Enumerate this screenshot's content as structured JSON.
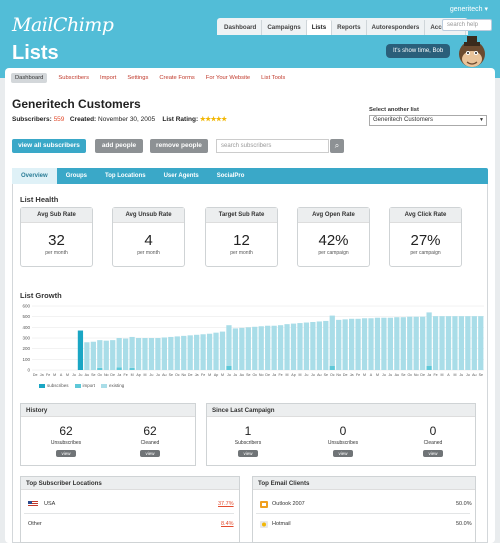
{
  "brand": "MailChimp",
  "user": "generitech",
  "nav": [
    "Dashboard",
    "Campaigns",
    "Lists",
    "Reports",
    "Autoresponders",
    "Account"
  ],
  "nav_active": 2,
  "help_placeholder": "search help",
  "page_title": "Lists",
  "show_time": "It's show time, Bob",
  "subnav": [
    "Dashboard",
    "Subscribers",
    "Import",
    "Settings",
    "Create Forms",
    "For Your Website",
    "List Tools"
  ],
  "list": {
    "name": "Generitech Customers",
    "subscribers_label": "Subscribers:",
    "subscribers": "559",
    "created_label": "Created:",
    "created": "November 30, 2005",
    "rating_label": "List Rating:",
    "rating": "★★★★★"
  },
  "select_label": "Select another list",
  "select_value": "Generitech Customers",
  "buttons": {
    "view_all": "view all subscribers",
    "add": "add people",
    "remove": "remove people"
  },
  "search_placeholder": "search subscribers",
  "tabs": [
    "Overview",
    "Groups",
    "Top Locations",
    "User Agents",
    "SocialPro"
  ],
  "health_title": "List Health",
  "health": [
    {
      "label": "Avg Sub Rate",
      "value": "32",
      "unit": "per month"
    },
    {
      "label": "Avg Unsub Rate",
      "value": "4",
      "unit": "per month"
    },
    {
      "label": "Target Sub Rate",
      "value": "12",
      "unit": "per month"
    },
    {
      "label": "Avg Open Rate",
      "value": "42%",
      "unit": "per campaign"
    },
    {
      "label": "Avg Click Rate",
      "value": "27%",
      "unit": "per campaign"
    }
  ],
  "growth_title": "List Growth",
  "chart_data": {
    "type": "bar",
    "stacked": true,
    "ylim": [
      0,
      600
    ],
    "yticks": [
      0,
      100,
      200,
      300,
      400,
      500,
      600
    ],
    "series": [
      {
        "name": "subscribes",
        "color": "#1aa6c4",
        "values": [
          0,
          0,
          0,
          0,
          0,
          0,
          0,
          370,
          0,
          0,
          0,
          0,
          0,
          0,
          0,
          0,
          0,
          0,
          0,
          0,
          0,
          0,
          0,
          0,
          0,
          0,
          0,
          0,
          0,
          0,
          0,
          0,
          0,
          0,
          0,
          0,
          0,
          0,
          0,
          0,
          0,
          0,
          0,
          0,
          0,
          0,
          0,
          0,
          0,
          0,
          0,
          0,
          0,
          0,
          0,
          0,
          0,
          0,
          0,
          0,
          0,
          0,
          0,
          0,
          0,
          0,
          0,
          0,
          0,
          0
        ]
      },
      {
        "name": "import",
        "color": "#5ec8d8",
        "values": [
          0,
          0,
          0,
          0,
          0,
          0,
          0,
          0,
          0,
          0,
          20,
          0,
          0,
          25,
          0,
          20,
          0,
          0,
          0,
          0,
          0,
          0,
          0,
          0,
          0,
          0,
          0,
          0,
          0,
          0,
          40,
          0,
          0,
          0,
          0,
          0,
          0,
          0,
          0,
          0,
          0,
          0,
          0,
          0,
          0,
          0,
          40,
          0,
          0,
          0,
          0,
          0,
          0,
          0,
          0,
          0,
          0,
          0,
          0,
          0,
          0,
          40,
          0,
          0,
          0,
          0,
          0,
          0,
          0,
          0
        ]
      },
      {
        "name": "existing",
        "color": "#a9dde8",
        "values": [
          0,
          0,
          0,
          0,
          0,
          0,
          0,
          0,
          260,
          265,
          260,
          275,
          280,
          275,
          295,
          290,
          300,
          300,
          300,
          300,
          305,
          310,
          315,
          320,
          325,
          330,
          335,
          340,
          350,
          360,
          380,
          390,
          395,
          400,
          405,
          410,
          415,
          415,
          420,
          430,
          435,
          440,
          445,
          450,
          455,
          460,
          470,
          470,
          475,
          480,
          480,
          485,
          485,
          490,
          490,
          490,
          495,
          495,
          500,
          500,
          500,
          500,
          505,
          505,
          505,
          505,
          505,
          505,
          505,
          505
        ]
      }
    ],
    "categories": [
      "De",
      "Ja",
      "Fe",
      "M",
      "A",
      "M",
      "Ju",
      "Ju",
      "Au",
      "Se",
      "Oc",
      "No",
      "De",
      "Ja",
      "Fe",
      "M",
      "Ap",
      "M",
      "Ju",
      "Ju",
      "Au",
      "Se",
      "Oc",
      "No",
      "De",
      "Ja",
      "Fe",
      "M",
      "Ap",
      "M",
      "Ju",
      "Ju",
      "Au",
      "Se",
      "Oc",
      "No",
      "De",
      "Ja",
      "Fe",
      "M",
      "Ap",
      "M",
      "Ju",
      "Ju",
      "Au",
      "Se",
      "Oc",
      "No",
      "De",
      "Ja",
      "Fe",
      "M",
      "A",
      "M",
      "Ju",
      "Ju",
      "Au",
      "Se",
      "Oc",
      "No",
      "De",
      "Ja",
      "Fe",
      "M",
      "A",
      "M",
      "Ju",
      "Ju",
      "Au",
      "Se"
    ]
  },
  "history": {
    "title": "History",
    "items": [
      {
        "value": "62",
        "label": "Unsubscribes",
        "btn": "view"
      },
      {
        "value": "62",
        "label": "Cleaned",
        "btn": "view"
      }
    ]
  },
  "since": {
    "title": "Since Last Campaign",
    "items": [
      {
        "value": "1",
        "label": "Subscribers",
        "btn": "view"
      },
      {
        "value": "0",
        "label": "Unsubscribes",
        "btn": "view"
      },
      {
        "value": "0",
        "label": "Cleaned",
        "btn": "view"
      }
    ]
  },
  "locations": {
    "title": "Top Subscriber Locations",
    "rows": [
      {
        "name": "USA",
        "pct": "37.7%"
      },
      {
        "name": "Other",
        "pct": "8.4%"
      }
    ]
  },
  "clients": {
    "title": "Top Email Clients",
    "rows": [
      {
        "name": "Outlook 2007",
        "pct": "50.0%"
      },
      {
        "name": "Hotmail",
        "pct": "50.0%"
      }
    ]
  }
}
